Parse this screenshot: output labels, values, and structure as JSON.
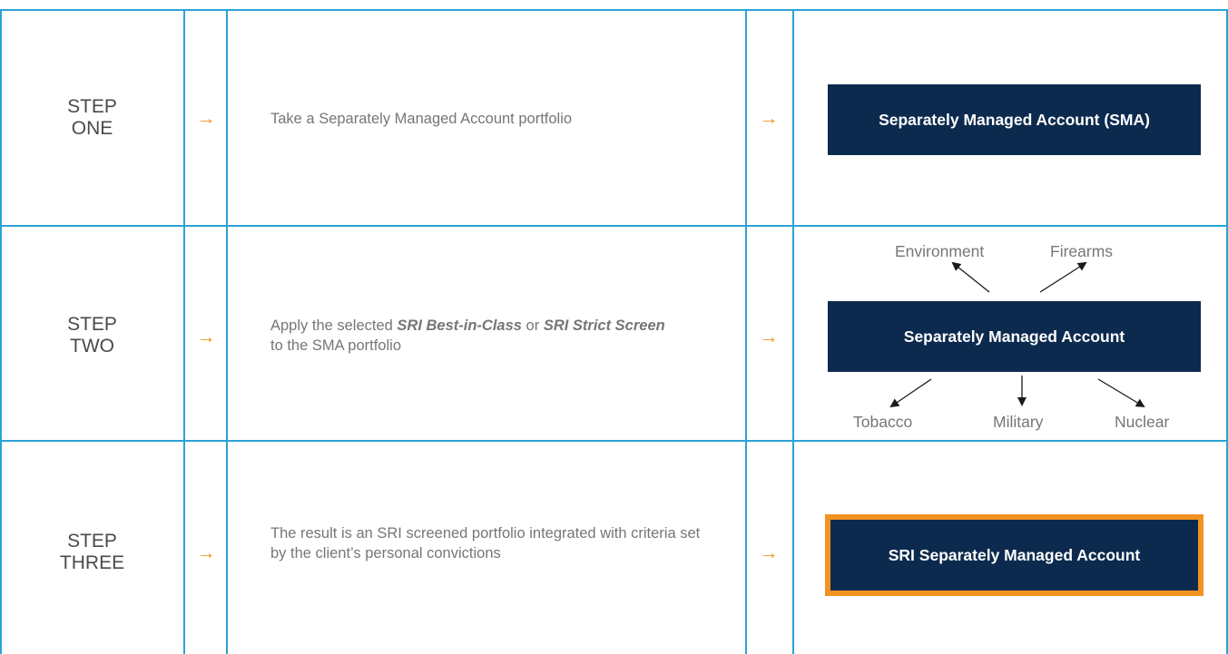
{
  "rows": [
    {
      "step_line1": "STEP",
      "step_line2": "ONE",
      "arrow1": "→",
      "arrow2": "→",
      "description": "Take a Separately Managed Account portfolio",
      "box_label": "Separately Managed Account (SMA)"
    },
    {
      "step_line1": "STEP",
      "step_line2": "TWO",
      "arrow1": "→",
      "arrow2": "→",
      "description_parts": {
        "p1": "Apply the selected ",
        "em1": "SRI Best-in-Class",
        "p2": " or ",
        "em2": "SRI Strict Screen",
        "p3": " to the SMA portfolio"
      },
      "box_label": "Separately Managed Account",
      "screens": {
        "top": [
          "Environment",
          "Firearms"
        ],
        "bottom": [
          "Tobacco",
          "Military",
          "Nuclear"
        ]
      }
    },
    {
      "step_line1": "STEP",
      "step_line2": "THREE",
      "arrow1": "→",
      "arrow2": "→",
      "description": "The result is an SRI screened portfolio integrated with criteria set by the client’s personal convictions",
      "box_label": "SRI Separately Managed Account"
    }
  ],
  "colors": {
    "grid": "#2aa3d6",
    "arrow": "#f29220",
    "box": "#0c2a4e",
    "highlight_border": "#f29220",
    "text": "#767676"
  }
}
